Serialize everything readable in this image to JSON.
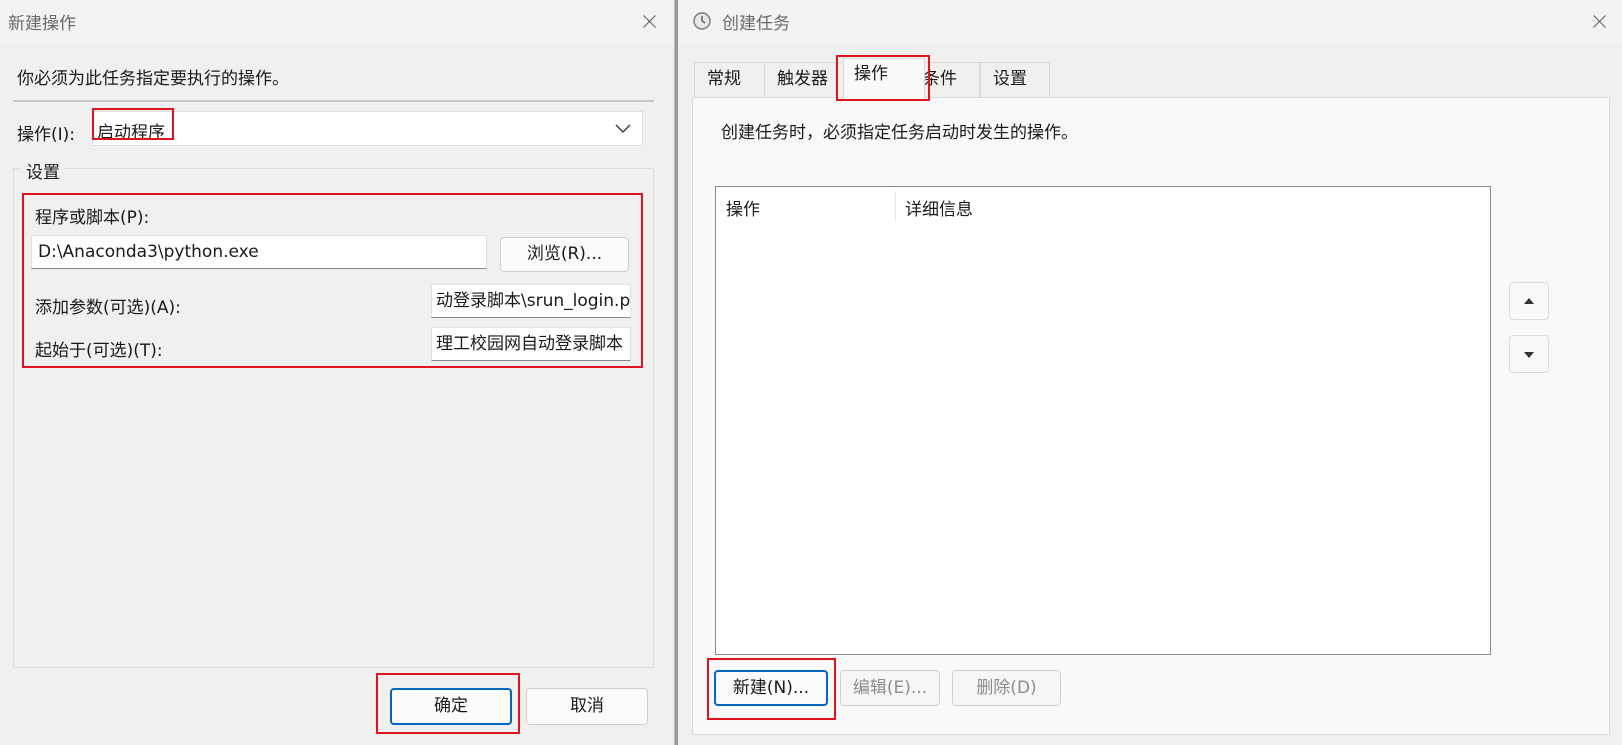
{
  "left_dialog": {
    "title": "新建操作",
    "instruction": "你必须为此任务指定要执行的操作。",
    "action_label": "操作(I):",
    "action_value": "启动程序",
    "settings_group_label": "设置",
    "program_label": "程序或脚本(P):",
    "program_value": "D:\\Anaconda3\\python.exe",
    "browse_button": "浏览(R)...",
    "args_label": "添加参数(可选)(A):",
    "args_value": "动登录脚本\\srun_login.py",
    "start_in_label": "起始于(可选)(T):",
    "start_in_value": "理工校园网自动登录脚本",
    "ok_button": "确定",
    "cancel_button": "取消"
  },
  "right_dialog": {
    "title": "创建任务",
    "tabs": [
      {
        "label": "常规"
      },
      {
        "label": "触发器"
      },
      {
        "label": "操作"
      },
      {
        "label": "条件"
      },
      {
        "label": "设置"
      }
    ],
    "active_tab": "操作",
    "description": "创建任务时，必须指定任务启动时发生的操作。",
    "table_columns": [
      "操作",
      "详细信息"
    ],
    "new_button": "新建(N)...",
    "edit_button": "编辑(E)...",
    "delete_button": "删除(D)"
  },
  "colors": {
    "highlight_red": "#e0141e",
    "primary_blue": "#0067c0"
  }
}
